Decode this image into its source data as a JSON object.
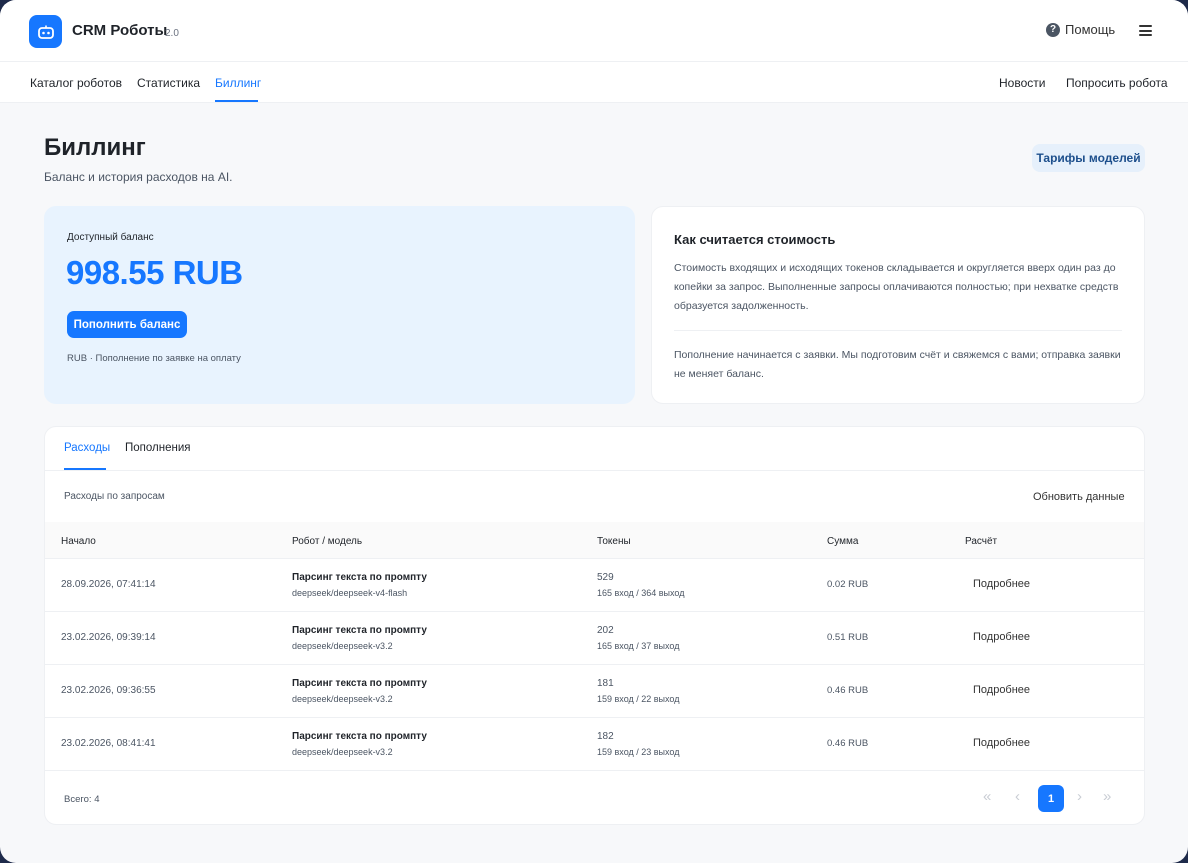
{
  "app": {
    "title": "CRM Роботы",
    "version": "2.0",
    "help_label": "Помощь",
    "help_glyph": "?"
  },
  "nav": {
    "left": [
      "Каталог роботов",
      "Статистика",
      "Биллинг"
    ],
    "active": "Биллинг",
    "right": [
      "Новости",
      "Попросить робота"
    ]
  },
  "page": {
    "title": "Биллинг",
    "subtitle": "Баланс и история расходов на AI.",
    "tariffs_button": "Тарифы моделей"
  },
  "balance": {
    "label": "Доступный баланс",
    "amount": "998.55 RUB",
    "topup_button": "Пополнить баланс",
    "note": "RUB · Пополнение по заявке на оплату"
  },
  "info": {
    "title": "Как считается стоимость",
    "text1": "Стоимость входящих и исходящих токенов складывается и округляется вверх один раз до копейки за запрос. Выполненные запросы оплачиваются полностью; при нехватке средств образуется задолженность.",
    "text2": "Пополнение начинается с заявки. Мы подготовим счёт и свяжемся с вами; отправка заявки не меняет баланс."
  },
  "tabs": {
    "expenses": "Расходы",
    "topups": "Пополнения",
    "active": "Расходы"
  },
  "table": {
    "caption": "Расходы по запросам",
    "refresh": "Обновить данные",
    "columns": {
      "start": "Начало",
      "robot_model": "Робот / модель",
      "tokens": "Токены",
      "sum": "Сумма",
      "calc": "Расчёт"
    },
    "rows": [
      {
        "date": "28.09.2026, 07:41:14",
        "task": "Парсинг текста по промпту",
        "model": "deepseek/deepseek-v4-flash",
        "tokens": "529",
        "tokens_detail": "165 вход / 364 выход",
        "sum": "0.02 RUB",
        "details": "Подробнее"
      },
      {
        "date": "23.02.2026, 09:39:14",
        "task": "Парсинг текста по промпту",
        "model": "deepseek/deepseek-v3.2",
        "tokens": "202",
        "tokens_detail": "165 вход / 37 выход",
        "sum": "0.51 RUB",
        "details": "Подробнее"
      },
      {
        "date": "23.02.2026, 09:36:55",
        "task": "Парсинг текста по промпту",
        "model": "deepseek/deepseek-v3.2",
        "tokens": "181",
        "tokens_detail": "159 вход / 22 выход",
        "sum": "0.46 RUB",
        "details": "Подробнее"
      },
      {
        "date": "23.02.2026, 08:41:41",
        "task": "Парсинг текста по промпту",
        "model": "deepseek/deepseek-v3.2",
        "tokens": "182",
        "tokens_detail": "159 вход / 23 выход",
        "sum": "0.46 RUB",
        "details": "Подробнее"
      }
    ],
    "total": "Всего: 4"
  },
  "pagination": {
    "current_page": "1",
    "first_glyph": "«",
    "prev_glyph": "‹",
    "next_glyph": "›",
    "last_glyph": "»"
  },
  "colors": {
    "accent": "#1677ff",
    "balance_card_bg": "#e8f3fe",
    "tariffs_button_bg": "#e6f0fb"
  },
  "icons": {
    "logo": "robot-icon",
    "help": "question-circle-icon",
    "menu": "hamburger-menu-icon"
  }
}
